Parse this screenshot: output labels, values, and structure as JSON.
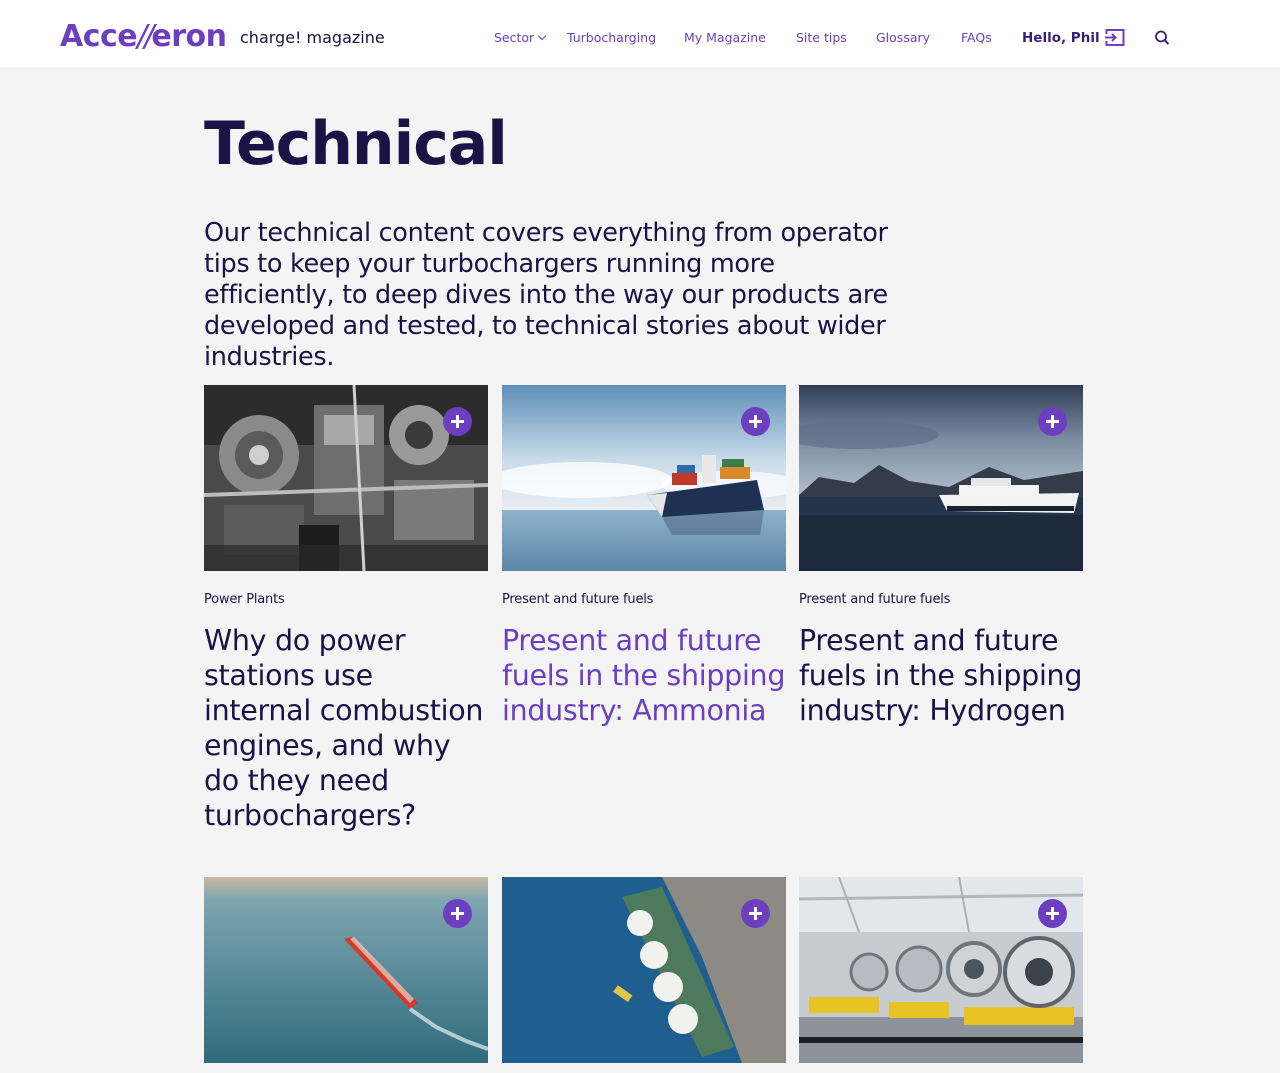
{
  "header": {
    "logo": {
      "pre": "Acce",
      "slash": "//",
      "post": "eron"
    },
    "magazine": "charge! magazine",
    "nav": [
      {
        "label": "Sector",
        "dropdown": true
      },
      {
        "label": "Turbocharging"
      },
      {
        "label": "My Magazine"
      },
      {
        "label": "Site tips"
      },
      {
        "label": "Glossary"
      },
      {
        "label": "FAQs"
      }
    ],
    "greeting": "Hello, Phil",
    "icons": [
      "logout-icon",
      "search-icon"
    ]
  },
  "page": {
    "title": "Technical",
    "intro": "Our technical content covers everything from operator tips to keep your turbochargers running more efficiently, to deep dives into the way our products are developed and tested, to technical stories about wider industries."
  },
  "cards": [
    {
      "category": "Power Plants",
      "title": "Why do power stations use internal combustion engines, and why do they need turbochargers?",
      "image": "engine-photo",
      "active": false
    },
    {
      "category": "Present and future fuels",
      "title": "Present and future fuels in the shipping industry: Ammonia",
      "image": "container-ship-photo",
      "active": true
    },
    {
      "category": "Present and future fuels",
      "title": "Present and future fuels in the shipping industry: Hydrogen",
      "image": "hydrogen-ferry-photo",
      "active": false
    },
    {
      "category": "",
      "title": "",
      "image": "red-tanker-photo",
      "active": false
    },
    {
      "category": "",
      "title": "",
      "image": "lng-carrier-photo",
      "active": false
    },
    {
      "category": "",
      "title": "",
      "image": "turbocharger-factory-photo",
      "active": false
    }
  ],
  "colors": {
    "brand": "#6b3fc0",
    "text": "#1b1246",
    "background": "#f4f4f5"
  }
}
